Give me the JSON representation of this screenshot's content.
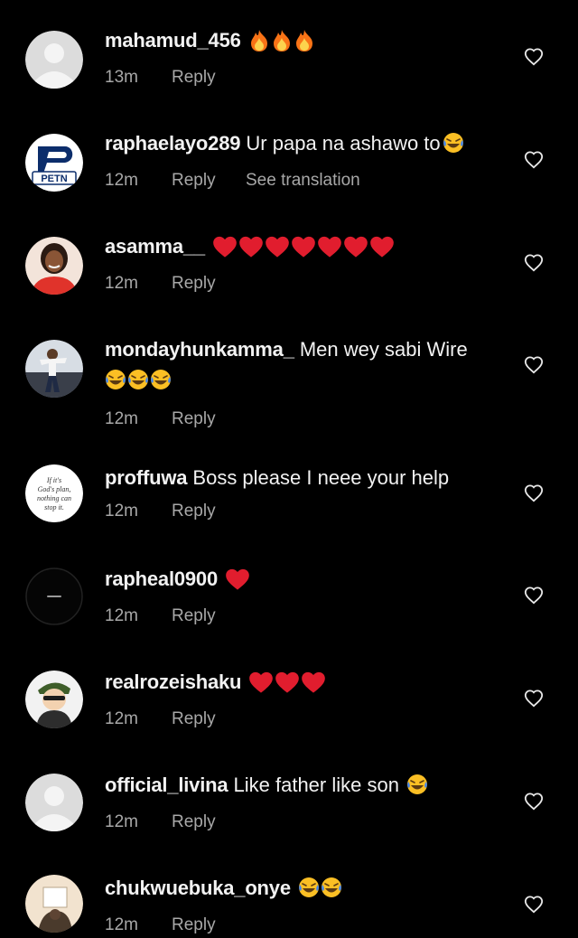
{
  "comments": [
    {
      "username": "mahamud_456",
      "text": "",
      "emojis": [
        "fire",
        "fire",
        "fire"
      ],
      "time": "13m",
      "reply_label": "Reply",
      "translation_label": ""
    },
    {
      "username": "raphaelayo289",
      "text": "Ur papa na ashawo to",
      "emojis": [
        "laughing"
      ],
      "time": "12m",
      "reply_label": "Reply",
      "translation_label": "See translation"
    },
    {
      "username": "asamma__",
      "text": "",
      "emojis": [
        "red-heart",
        "red-heart",
        "red-heart",
        "red-heart",
        "red-heart",
        "red-heart",
        "red-heart"
      ],
      "time": "12m",
      "reply_label": "Reply",
      "translation_label": ""
    },
    {
      "username": "mondayhunkamma_",
      "text": "Men wey sabi Wire",
      "emojis": [
        "laughing",
        "laughing",
        "laughing"
      ],
      "time": "12m",
      "reply_label": "Reply",
      "translation_label": ""
    },
    {
      "username": "proffuwa",
      "text": "Boss please I neee your help",
      "emojis": [],
      "time": "12m",
      "reply_label": "Reply",
      "translation_label": ""
    },
    {
      "username": "rapheal0900",
      "text": "",
      "emojis": [
        "red-heart"
      ],
      "time": "12m",
      "reply_label": "Reply",
      "translation_label": ""
    },
    {
      "username": "realrozeishaku",
      "text": "",
      "emojis": [
        "red-heart",
        "red-heart",
        "red-heart"
      ],
      "time": "12m",
      "reply_label": "Reply",
      "translation_label": ""
    },
    {
      "username": "official_livina",
      "text": "Like father like son",
      "emojis": [
        "laughing"
      ],
      "time": "12m",
      "reply_label": "Reply",
      "translation_label": ""
    },
    {
      "username": "chukwuebuka_onye",
      "text": "",
      "emojis": [
        "laughing",
        "laughing"
      ],
      "time": "12m",
      "reply_label": "Reply",
      "translation_label": ""
    }
  ],
  "avatars": {
    "raphaelayo289": {
      "logo_text": "PETN"
    },
    "proffuwa": {
      "quote_text": "If it's God's plan, nothing can stop it."
    }
  },
  "colors": {
    "background": "#000000",
    "username": "#f2f2f2",
    "meta": "#a8a8a8",
    "heart_icon": "#e8e8e8"
  }
}
